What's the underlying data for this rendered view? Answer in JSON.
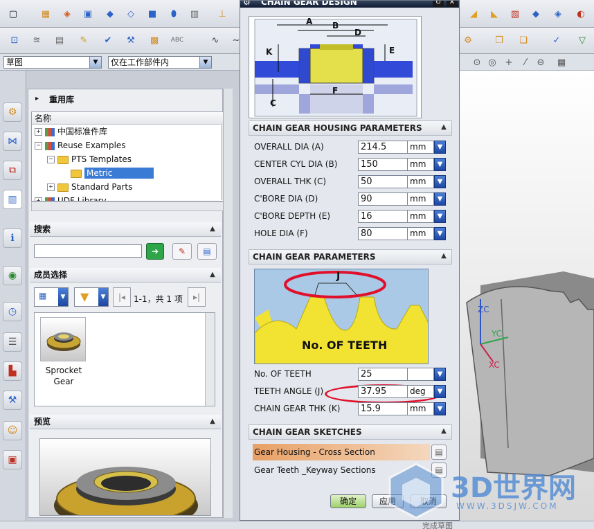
{
  "toolbar": {
    "sketch_combo": "草图",
    "scope_combo": "仅在工作部件内"
  },
  "reuse_panel": {
    "title": "重用库",
    "name_header": "名称",
    "tree": [
      {
        "label": "中国标准件库",
        "expander": "+",
        "icon": "library-icon"
      },
      {
        "label": "Reuse Examples",
        "expander": "−",
        "icon": "library-icon"
      },
      {
        "label": "PTS Templates",
        "expander": "−",
        "icon": "folder-icon"
      },
      {
        "label": "Metric",
        "expander": "",
        "icon": "folder-icon"
      },
      {
        "label": "Standard Parts",
        "expander": "+",
        "icon": "folder-icon"
      },
      {
        "label": "UDF Library",
        "expander": "+",
        "icon": "library-icon"
      }
    ]
  },
  "search_section": {
    "title": "搜索",
    "query": ""
  },
  "member_section": {
    "title": "成员选择",
    "paging": "1-1，共 1 项",
    "item_label_line1": "Sprocket",
    "item_label_line2": "Gear"
  },
  "preview_section": {
    "title": "预览"
  },
  "dialog": {
    "title": "CHAIN GEAR DESIGN",
    "housing_section": {
      "title": "CHAIN GEAR HOUSING PARAMETERS",
      "params": [
        {
          "label": "OVERALL DIA (A)",
          "value": "214.5",
          "unit": "mm"
        },
        {
          "label": "CENTER CYL DIA (B)",
          "value": "150",
          "unit": "mm"
        },
        {
          "label": "OVERALL THK (C)",
          "value": "50",
          "unit": "mm"
        },
        {
          "label": "C'BORE DIA (D)",
          "value": "90",
          "unit": "mm"
        },
        {
          "label": "C'BORE DEPTH (E)",
          "value": "16",
          "unit": "mm"
        },
        {
          "label": "HOLE DIA (F)",
          "value": "80",
          "unit": "mm"
        }
      ]
    },
    "gear_section": {
      "title": "CHAIN GEAR PARAMETERS",
      "image_text": "No. OF TEETH",
      "angle_letter": "J",
      "params": [
        {
          "label": "No. OF TEETH",
          "value": "25",
          "unit": ""
        },
        {
          "label": "TEETH ANGLE (J)",
          "value": "37.95",
          "unit": "deg"
        },
        {
          "label": "CHAIN GEAR THK (K)",
          "value": "15.9",
          "unit": "mm"
        }
      ]
    },
    "sketch_section": {
      "title": "CHAIN GEAR SKETCHES",
      "items": [
        "Gear Housing - Cross Section",
        "Gear Teeth _Keyway Sections"
      ]
    },
    "diagram_labels": {
      "a": "A",
      "b": "B",
      "c": "C",
      "d": "D",
      "e": "E",
      "f": "F",
      "k": "K"
    },
    "ok_label": "确定",
    "apply_label": "应用",
    "cancel_label": "取消"
  },
  "viewport": {
    "axis_zc": "ZC",
    "axis_yc": "YC",
    "axis_xc": "XC"
  },
  "watermark": {
    "brand": "3D世界网",
    "url": "WWW.3DSJW.COM"
  },
  "status_bar": {
    "hint": "完成草图"
  },
  "colors": {
    "accent_blue": "#1f4fb0",
    "gear_yellow": "#f2e232",
    "annotation_red": "#e0102a",
    "highlight_orange": "#e8a065"
  }
}
